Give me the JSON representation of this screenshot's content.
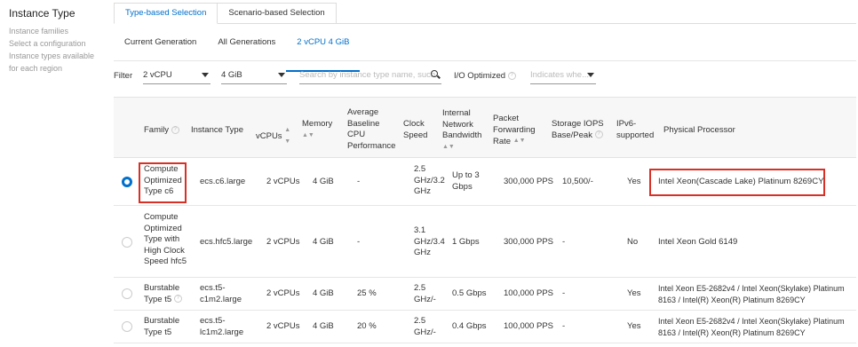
{
  "sidebar": {
    "title": "Instance Type",
    "help_lines": [
      "Instance families",
      "Select a configuration",
      "Instance types available",
      "for each region"
    ]
  },
  "tabs": [
    "Type-based Selection",
    "Scenario-based Selection"
  ],
  "subtabs": [
    "Current Generation",
    "All Generations",
    "2 vCPU 4 GiB"
  ],
  "filter": {
    "label": "Filter",
    "vcpu": "2 vCPU",
    "memory": "4 GiB",
    "search_placeholder": "Search by instance type name, such",
    "io_label": "I/O Optimized",
    "io_placeholder": "Indicates whe..."
  },
  "table": {
    "headers": {
      "family": "Family",
      "instance_type": "Instance Type",
      "vcpus": "vCPUs",
      "memory": "Memory",
      "baseline": [
        "Average",
        "Baseline",
        "CPU",
        "Performance"
      ],
      "clock": [
        "Clock",
        "Speed"
      ],
      "bandwidth": [
        "Internal",
        "Network",
        "Bandwidth"
      ],
      "pps": [
        "Packet",
        "Forwarding",
        "Rate"
      ],
      "iops": [
        "Storage IOPS",
        "Base/Peak"
      ],
      "ipv6": [
        "IPv6-",
        "supported"
      ],
      "processor": "Physical Processor"
    },
    "rows": [
      {
        "selected": true,
        "family": [
          "Compute",
          "Optimized",
          "Type c6"
        ],
        "type": [
          "ecs.c6.large"
        ],
        "vcpus": "2 vCPUs",
        "memory": "4 GiB",
        "baseline": "-",
        "clock": [
          "2.5",
          "GHz/3.2",
          "GHz"
        ],
        "bandwidth": [
          "Up to 3",
          "Gbps"
        ],
        "pps": "300,000 PPS",
        "iops": "10,500/-",
        "ipv6": "Yes",
        "processor": [
          "Intel Xeon(Cascade Lake) Platinum 8269CY"
        ]
      },
      {
        "selected": false,
        "family": [
          "Compute",
          "Optimized",
          "Type with",
          "High Clock",
          "Speed hfc5"
        ],
        "type": [
          "ecs.hfc5.large"
        ],
        "vcpus": "2 vCPUs",
        "memory": "4 GiB",
        "baseline": "-",
        "clock": [
          "3.1",
          "GHz/3.4",
          "GHz"
        ],
        "bandwidth": [
          "1 Gbps"
        ],
        "pps": "300,000 PPS",
        "iops": "-",
        "ipv6": "No",
        "processor": [
          "Intel Xeon Gold 6149"
        ]
      },
      {
        "selected": false,
        "family": [
          "Burstable",
          "Type t5"
        ],
        "type": [
          "ecs.t5-",
          "c1m2.large"
        ],
        "vcpus": "2 vCPUs",
        "memory": "4 GiB",
        "baseline": "25 %",
        "clock": [
          "2.5",
          "GHz/-"
        ],
        "bandwidth": [
          "0.5 Gbps"
        ],
        "pps": "100,000 PPS",
        "iops": "-",
        "ipv6": "Yes",
        "processor": [
          "Intel Xeon E5-2682v4 / Intel Xeon(Skylake) Platinum",
          "8163 / Intel(R) Xeon(R) Platinum 8269CY"
        ]
      },
      {
        "selected": false,
        "family": [
          "Burstable",
          "Type t5"
        ],
        "type": [
          "ecs.t5-",
          "lc1m2.large"
        ],
        "vcpus": "2 vCPUs",
        "memory": "4 GiB",
        "baseline": "20 %",
        "clock": [
          "2.5",
          "GHz/-"
        ],
        "bandwidth": [
          "0.4 Gbps"
        ],
        "pps": "100,000 PPS",
        "iops": "-",
        "ipv6": "Yes",
        "processor": [
          "Intel Xeon E5-2682v4 / Intel Xeon(Skylake) Platinum",
          "8163 / Intel(R) Xeon(R) Platinum 8269CY"
        ]
      }
    ]
  },
  "colors": {
    "accent": "#0070cc",
    "highlight": "#d93026"
  }
}
